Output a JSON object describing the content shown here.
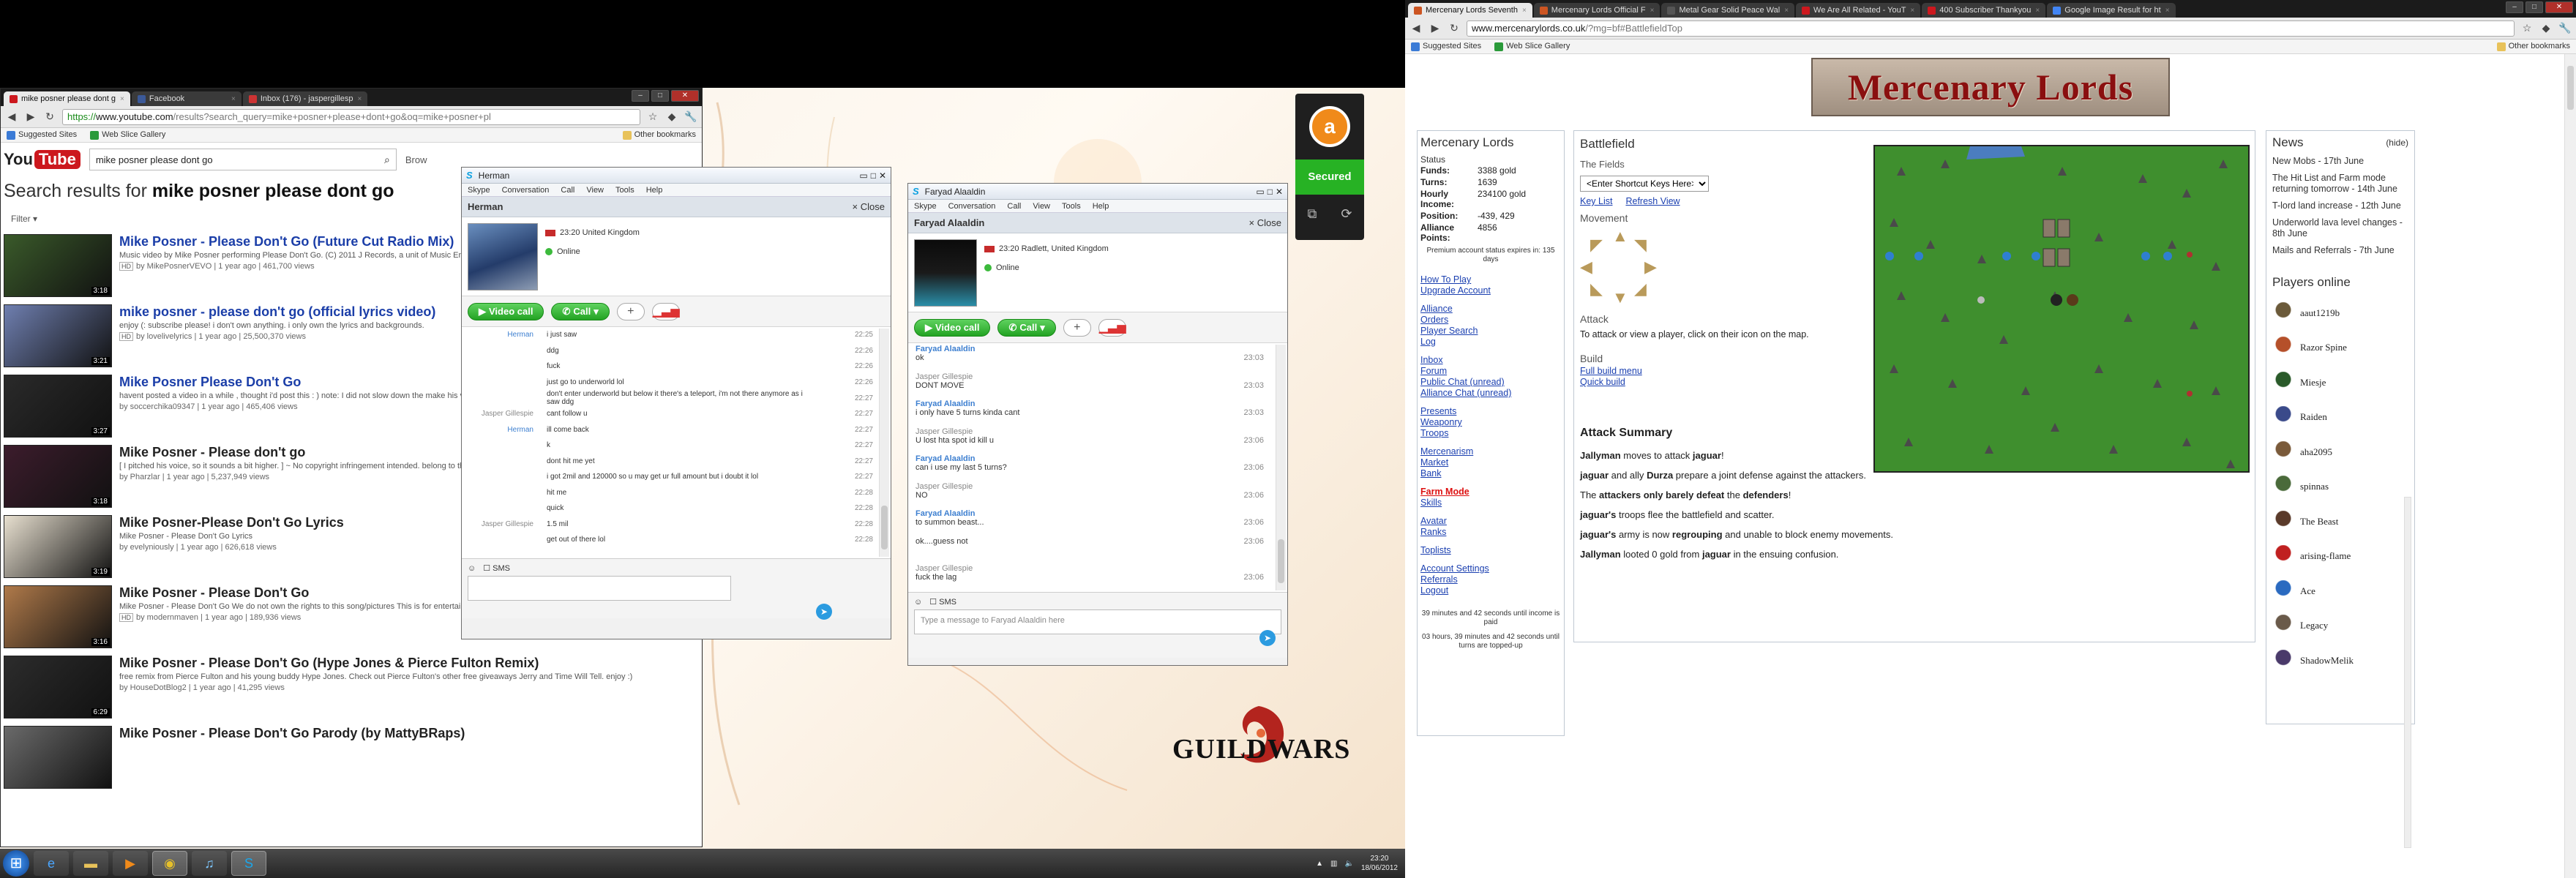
{
  "youtube_window": {
    "tabs": [
      {
        "label": "mike posner please dont g",
        "color": "#cc181e"
      },
      {
        "label": "Facebook",
        "color": "#3b5998"
      },
      {
        "label": "Inbox (176) - jaspergillesp",
        "color": "#c33"
      }
    ],
    "url": {
      "proto": "https://",
      "host": "www.youtube.com",
      "rest": "/results?search_query=mike+posner+please+dont+go&oq=mike+posner+pl"
    },
    "bookmarks": {
      "suggested": "Suggested Sites",
      "webslice": "Web Slice Gallery",
      "other": "Other bookmarks"
    },
    "logo_you": "You",
    "logo_tube": "Tube",
    "search_value": "mike posner please dont go",
    "browse_label": "Brow",
    "results_prefix": "Search results for ",
    "results_query": "mike posner please dont go",
    "filter_label": "Filter ▾",
    "videos": [
      {
        "title": "Mike Posner - Please Don't Go (Future Cut Radio Mix)",
        "desc": "Music video by Mike Posner performing Please Don't Go. (C) 2011 J Records, a unit of Music Entertainment",
        "meta": "by MikePosnerVEVO | 1 year ago | 461,700 views",
        "hd": "HD",
        "dur": "3:18",
        "plain": false
      },
      {
        "title": "mike posner - please don't go (official lyrics video)",
        "desc": "enjoy (: subscribe please! i don't own anything. i only own the lyrics and backgrounds.",
        "meta": "by lovelivelyrics | 1 year ago | 25,500,370 views",
        "hd": "HD",
        "dur": "3:21",
        "plain": false
      },
      {
        "title": "Mike Posner Please Don't Go",
        "desc": "havent posted a video in a while , thought i'd post this : ) note: I did not slow down the make his voice deeper. I did not do ANYTHING",
        "meta": "by soccerchika09347 | 1 year ago | 465,406 views",
        "hd": "",
        "dur": "3:27",
        "plain": false
      },
      {
        "title": "Mike Posner - Please don't go",
        "desc": "[ I pitched his voice, so it sounds a bit higher. ] ~ No copyright infringement intended. belong to their rightful owner ~ I do not ...",
        "meta": "by Pharzlar | 1 year ago | 5,237,949 views",
        "hd": "",
        "dur": "3:18",
        "plain": true
      },
      {
        "title": "Mike Posner-Please Don't Go Lyrics",
        "desc": "Mike Posner - Please Don't Go Lyrics",
        "meta": "by evelyniously | 1 year ago | 626,618 views",
        "hd": "",
        "dur": "3:19",
        "plain": true
      },
      {
        "title": "Mike Posner - Please Don't Go",
        "desc": "Mike Posner - Please Don't Go We do not own the rights to this song/pictures This is for entertainment purposes only modernmaven.com Lyrics ...",
        "meta": "by modernmaven | 1 year ago | 189,936 views",
        "hd": "HD",
        "dur": "3:16",
        "plain": true
      },
      {
        "title": "Mike Posner - Please Don't Go (Hype Jones & Pierce Fulton Remix)",
        "desc": "free remix from Pierce Fulton and his young buddy Hype Jones. Check out Pierce Fulton's other free giveaways Jerry and Time Will Tell. enjoy :)",
        "meta": "by HouseDotBlog2 | 1 year ago | 41,295 views",
        "hd": "",
        "dur": "6:29",
        "plain": true
      },
      {
        "title": "Mike Posner - Please Don't Go Parody (by MattyBRaps)",
        "desc": "",
        "meta": "",
        "hd": "",
        "dur": "",
        "plain": true
      }
    ]
  },
  "skype_herman": {
    "title": "Herman",
    "menu": [
      "Skype",
      "Conversation",
      "Call",
      "View",
      "Tools",
      "Help"
    ],
    "contact": "Herman",
    "close_label": "Close",
    "location": "23:20 United Kingdom",
    "status": "Online",
    "video_call": "Video call",
    "call": "Call",
    "messages": [
      {
        "who": "Herman",
        "me": true,
        "msg": "i just saw",
        "time": "22:25"
      },
      {
        "who": "",
        "me": false,
        "msg": "ddg",
        "time": "22:26"
      },
      {
        "who": "",
        "me": false,
        "msg": "fuck",
        "time": "22:26"
      },
      {
        "who": "",
        "me": false,
        "msg": "just go to underworld lol",
        "time": "22:26"
      },
      {
        "who": "",
        "me": false,
        "msg": "don't enter underworld but below it there's a teleport, i'm not there anymore as i saw ddg",
        "time": "22:27"
      },
      {
        "who": "Jasper Gillespie",
        "me": false,
        "msg": "cant follow u",
        "time": "22:27"
      },
      {
        "who": "Herman",
        "me": true,
        "msg": "ill come back",
        "time": "22:27"
      },
      {
        "who": "",
        "me": false,
        "msg": "k",
        "time": "22:27"
      },
      {
        "who": "",
        "me": false,
        "msg": "dont hit me yet",
        "time": "22:27"
      },
      {
        "who": "",
        "me": false,
        "msg": "i got 2mil and 120000 so u may get ur full amount but i doubt it lol",
        "time": "22:27"
      },
      {
        "who": "",
        "me": false,
        "msg": "hit me",
        "time": "22:28"
      },
      {
        "who": "",
        "me": false,
        "msg": "quick",
        "time": "22:28"
      },
      {
        "who": "Jasper Gillespie",
        "me": false,
        "msg": "1.5 mil",
        "time": "22:28"
      },
      {
        "who": "",
        "me": false,
        "msg": "get out of there lol",
        "time": "22:28"
      }
    ],
    "sms": "SMS"
  },
  "skype_faryad": {
    "title": "Faryad Alaaldin",
    "menu": [
      "Skype",
      "Conversation",
      "Call",
      "View",
      "Tools",
      "Help"
    ],
    "contact": "Faryad Alaaldin",
    "close_label": "Close",
    "location": "23:20 Radlett, United Kingdom",
    "status": "Online",
    "video_call": "Video call",
    "call": "Call",
    "messages": [
      {
        "who": "Faryad Alaaldin",
        "me": true,
        "msg": "ok",
        "time": "23:03"
      },
      {
        "who": "Jasper Gillespie",
        "me": false,
        "msg": "DONT MOVE",
        "time": "23:03"
      },
      {
        "who": "Faryad Alaaldin",
        "me": true,
        "msg": "i only have 5 turns kinda cant",
        "time": "23:03"
      },
      {
        "who": "Jasper Gillespie",
        "me": false,
        "msg": "U lost hta spot id kill u",
        "time": "23:06"
      },
      {
        "who": "Faryad Alaaldin",
        "me": true,
        "msg": "can i use my last 5 turns?",
        "time": "23:06"
      },
      {
        "who": "Jasper Gillespie",
        "me": false,
        "msg": "NO",
        "time": "23:06"
      },
      {
        "who": "Faryad Alaaldin",
        "me": true,
        "msg": "to summon beast...",
        "time": "23:06"
      },
      {
        "who": "",
        "me": false,
        "msg": "ok....guess not",
        "time": "23:06"
      },
      {
        "who": "Jasper Gillespie",
        "me": false,
        "msg": "fuck the lag",
        "time": "23:06"
      }
    ],
    "sms": "SMS",
    "placeholder": "Type a message to Faryad Alaaldin here"
  },
  "avast": {
    "status": "Secured",
    "letter": "a"
  },
  "guildwars": {
    "word": "GUILDWARS"
  },
  "taskbar": {
    "time": "23:20",
    "date": "18/06/2012"
  },
  "ml_window": {
    "tabs": [
      {
        "label": "Mercenary Lords Seventh",
        "color": "#c52"
      },
      {
        "label": "Mercenary Lords Official F",
        "color": "#c52"
      },
      {
        "label": "Metal Gear Solid Peace Wal",
        "color": "#555"
      },
      {
        "label": "We Are All Related - YouT",
        "color": "#cc181e"
      },
      {
        "label": "400 Subscriber Thankyou",
        "color": "#cc181e"
      },
      {
        "label": "Google Image Result for ht",
        "color": "#4285f4"
      }
    ],
    "url": {
      "host": "www.mercenarylords.co.uk",
      "rest": "/?mg=bf#BattlefieldTop"
    },
    "bookmarks": {
      "suggested": "Suggested Sites",
      "webslice": "Web Slice Gallery",
      "other": "Other bookmarks"
    },
    "banner": "Mercenary Lords",
    "left": {
      "title": "Mercenary Lords",
      "status_label": "Status",
      "stats": [
        {
          "k": "Funds:",
          "v": "3388 gold"
        },
        {
          "k": "Turns:",
          "v": "1639"
        },
        {
          "k": "Hourly Income:",
          "v": "234100 gold"
        },
        {
          "k": "Position:",
          "v": "-439, 429"
        },
        {
          "k": "Alliance Points:",
          "v": "4856"
        }
      ],
      "premium": "Premium account status expires in: 135 days",
      "links1": [
        "How To Play",
        "Upgrade Account"
      ],
      "links2": [
        "Alliance",
        "Orders",
        "Player Search",
        "Log"
      ],
      "links3": [
        "Inbox",
        "Forum",
        "Public Chat (unread)",
        "Alliance Chat (unread)"
      ],
      "links4": [
        "Presents",
        "Weaponry",
        "Troops"
      ],
      "links5": [
        "Mercenarism",
        "Market",
        "Bank"
      ],
      "links6_red": "Farm Mode",
      "links6": [
        "Skills"
      ],
      "links7": [
        "Avatar",
        "Ranks"
      ],
      "links8": [
        "Toplists"
      ],
      "links9": [
        "Account Settings",
        "Referrals",
        "Logout"
      ],
      "income_note": "39 minutes and 42 seconds until income is paid",
      "turns_note": "03 hours, 39 minutes and 42 seconds until turns are topped-up"
    },
    "battlefield": {
      "title": "Battlefield",
      "sub": "The Fields",
      "shortcut": "<Enter Shortcut Keys Here>",
      "key_list": "Key List",
      "refresh": "Refresh View",
      "movement": "Movement",
      "attack_title": "Attack",
      "attack_text": "To attack or view a player, click on their icon on the map.",
      "build_title": "Build",
      "build_links": [
        "Full build menu",
        "Quick build"
      ]
    },
    "attack_summary": {
      "title": "Attack Summary",
      "lines": [
        [
          "Jallyman",
          " moves to attack ",
          "jaguar",
          "!"
        ],
        [
          "jaguar",
          " and ally ",
          "Durza",
          " prepare a joint defense against the attackers."
        ],
        [
          "The ",
          "attackers only barely defeat",
          " the ",
          "defenders",
          "!"
        ],
        [
          "jaguar's",
          " troops flee the battlefield and scatter."
        ],
        [
          "jaguar's",
          " army is now ",
          "regrouping",
          " and unable to block enemy movements."
        ],
        [
          "Jallyman",
          " looted 0 gold from ",
          "jaguar",
          " in the ensuing confusion."
        ]
      ]
    },
    "news": {
      "title": "News",
      "hide": "(hide)",
      "items": [
        {
          "link": "New Mobs",
          "rest": " - 17th June"
        },
        {
          "link": "The Hit List and Farm mode returning tomorrow",
          "rest": " - 14th June"
        },
        {
          "link": "T-lord land increase",
          "rest": " - 12th June"
        },
        {
          "link": "Underworld lava level changes",
          "rest": " - 8th June"
        },
        {
          "link": "Mails and Referrals",
          "rest": " - 7th June"
        }
      ]
    },
    "players_title": "Players online",
    "players": [
      "aaut1219b",
      "Razor Spine",
      "Miesje",
      "Raiden",
      "aha2095",
      "spinnas",
      "The Beast",
      "arising-flame",
      "Ace",
      "Legacy",
      "ShadowMelik"
    ]
  }
}
